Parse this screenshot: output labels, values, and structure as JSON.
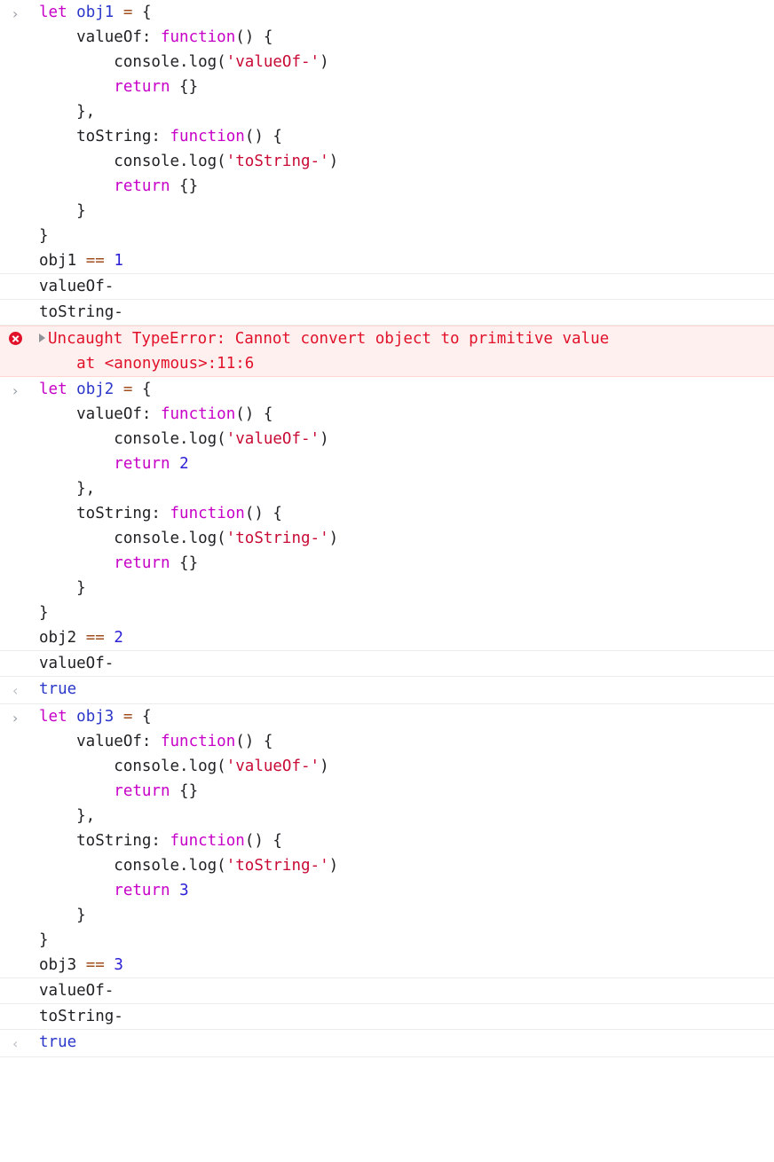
{
  "app": {
    "name": "browser-devtools-console",
    "theme": "light"
  },
  "colors": {
    "keyword": "#c700c7",
    "identifier": "#2a37c9",
    "operator": "#a14d1d",
    "string": "#c80a34",
    "number": "#2a1fd4",
    "plain": "#202124",
    "error_text": "#e2112a",
    "error_background": "#fdf0ef",
    "error_border": "#ffd6d2",
    "gutter": "#9aa0a6",
    "separator": "#ececec",
    "result": "#2a37c9"
  },
  "markers": {
    "input_prompt": "›",
    "result_prompt": "‹",
    "error_icon": "error-circle-x-icon",
    "error_disclosure": "disclosure-triangle-right-icon"
  },
  "entries": [
    {
      "kind": "input",
      "name": "console-input-obj1",
      "lines": [
        [
          {
            "t": "let ",
            "c": "kw"
          },
          {
            "t": "obj1",
            "c": "ident"
          },
          {
            "t": " ",
            "c": "plain"
          },
          {
            "t": "=",
            "c": "op"
          },
          {
            "t": " {",
            "c": "plain"
          }
        ],
        [
          {
            "t": "    valueOf: ",
            "c": "plain"
          },
          {
            "t": "function",
            "c": "kw"
          },
          {
            "t": "() {",
            "c": "plain"
          }
        ],
        [
          {
            "t": "        console.log(",
            "c": "plain"
          },
          {
            "t": "'valueOf-'",
            "c": "str"
          },
          {
            "t": ")",
            "c": "plain"
          }
        ],
        [
          {
            "t": "        ",
            "c": "plain"
          },
          {
            "t": "return",
            "c": "kw"
          },
          {
            "t": " {}",
            "c": "plain"
          }
        ],
        [
          {
            "t": "    },",
            "c": "plain"
          }
        ],
        [
          {
            "t": "    toString: ",
            "c": "plain"
          },
          {
            "t": "function",
            "c": "kw"
          },
          {
            "t": "() {",
            "c": "plain"
          }
        ],
        [
          {
            "t": "        console.log(",
            "c": "plain"
          },
          {
            "t": "'toString-'",
            "c": "str"
          },
          {
            "t": ")",
            "c": "plain"
          }
        ],
        [
          {
            "t": "        ",
            "c": "plain"
          },
          {
            "t": "return",
            "c": "kw"
          },
          {
            "t": " {}",
            "c": "plain"
          }
        ],
        [
          {
            "t": "    }",
            "c": "plain"
          }
        ],
        [
          {
            "t": "}",
            "c": "plain"
          }
        ],
        [
          {
            "t": "obj1 ",
            "c": "plain"
          },
          {
            "t": "==",
            "c": "op"
          },
          {
            "t": " ",
            "c": "plain"
          },
          {
            "t": "1",
            "c": "num"
          }
        ]
      ]
    },
    {
      "kind": "log",
      "name": "console-log-valueof-1",
      "text": "valueOf-"
    },
    {
      "kind": "log",
      "name": "console-log-tostring-1",
      "text": "toString-"
    },
    {
      "kind": "error",
      "name": "console-error-typeerror",
      "message": "Uncaught TypeError: Cannot convert object to primitive value",
      "stack": "    at <anonymous>:11:6"
    },
    {
      "kind": "input",
      "name": "console-input-obj2",
      "lines": [
        [
          {
            "t": "let ",
            "c": "kw"
          },
          {
            "t": "obj2",
            "c": "ident"
          },
          {
            "t": " ",
            "c": "plain"
          },
          {
            "t": "=",
            "c": "op"
          },
          {
            "t": " {",
            "c": "plain"
          }
        ],
        [
          {
            "t": "    valueOf: ",
            "c": "plain"
          },
          {
            "t": "function",
            "c": "kw"
          },
          {
            "t": "() {",
            "c": "plain"
          }
        ],
        [
          {
            "t": "        console.log(",
            "c": "plain"
          },
          {
            "t": "'valueOf-'",
            "c": "str"
          },
          {
            "t": ")",
            "c": "plain"
          }
        ],
        [
          {
            "t": "        ",
            "c": "plain"
          },
          {
            "t": "return",
            "c": "kw"
          },
          {
            "t": " ",
            "c": "plain"
          },
          {
            "t": "2",
            "c": "num"
          }
        ],
        [
          {
            "t": "    },",
            "c": "plain"
          }
        ],
        [
          {
            "t": "    toString: ",
            "c": "plain"
          },
          {
            "t": "function",
            "c": "kw"
          },
          {
            "t": "() {",
            "c": "plain"
          }
        ],
        [
          {
            "t": "        console.log(",
            "c": "plain"
          },
          {
            "t": "'toString-'",
            "c": "str"
          },
          {
            "t": ")",
            "c": "plain"
          }
        ],
        [
          {
            "t": "        ",
            "c": "plain"
          },
          {
            "t": "return",
            "c": "kw"
          },
          {
            "t": " {}",
            "c": "plain"
          }
        ],
        [
          {
            "t": "    }",
            "c": "plain"
          }
        ],
        [
          {
            "t": "}",
            "c": "plain"
          }
        ],
        [
          {
            "t": "obj2 ",
            "c": "plain"
          },
          {
            "t": "==",
            "c": "op"
          },
          {
            "t": " ",
            "c": "plain"
          },
          {
            "t": "2",
            "c": "num"
          }
        ]
      ]
    },
    {
      "kind": "log",
      "name": "console-log-valueof-2",
      "text": "valueOf-"
    },
    {
      "kind": "result",
      "name": "console-result-true-1",
      "text": "true"
    },
    {
      "kind": "input",
      "name": "console-input-obj3",
      "lines": [
        [
          {
            "t": "let ",
            "c": "kw"
          },
          {
            "t": "obj3",
            "c": "ident"
          },
          {
            "t": " ",
            "c": "plain"
          },
          {
            "t": "=",
            "c": "op"
          },
          {
            "t": " {",
            "c": "plain"
          }
        ],
        [
          {
            "t": "    valueOf: ",
            "c": "plain"
          },
          {
            "t": "function",
            "c": "kw"
          },
          {
            "t": "() {",
            "c": "plain"
          }
        ],
        [
          {
            "t": "        console.log(",
            "c": "plain"
          },
          {
            "t": "'valueOf-'",
            "c": "str"
          },
          {
            "t": ")",
            "c": "plain"
          }
        ],
        [
          {
            "t": "        ",
            "c": "plain"
          },
          {
            "t": "return",
            "c": "kw"
          },
          {
            "t": " {}",
            "c": "plain"
          }
        ],
        [
          {
            "t": "    },",
            "c": "plain"
          }
        ],
        [
          {
            "t": "    toString: ",
            "c": "plain"
          },
          {
            "t": "function",
            "c": "kw"
          },
          {
            "t": "() {",
            "c": "plain"
          }
        ],
        [
          {
            "t": "        console.log(",
            "c": "plain"
          },
          {
            "t": "'toString-'",
            "c": "str"
          },
          {
            "t": ")",
            "c": "plain"
          }
        ],
        [
          {
            "t": "        ",
            "c": "plain"
          },
          {
            "t": "return",
            "c": "kw"
          },
          {
            "t": " ",
            "c": "plain"
          },
          {
            "t": "3",
            "c": "num"
          }
        ],
        [
          {
            "t": "    }",
            "c": "plain"
          }
        ],
        [
          {
            "t": "}",
            "c": "plain"
          }
        ],
        [
          {
            "t": "obj3 ",
            "c": "plain"
          },
          {
            "t": "==",
            "c": "op"
          },
          {
            "t": " ",
            "c": "plain"
          },
          {
            "t": "3",
            "c": "num"
          }
        ]
      ]
    },
    {
      "kind": "log",
      "name": "console-log-valueof-3",
      "text": "valueOf-"
    },
    {
      "kind": "log",
      "name": "console-log-tostring-3",
      "text": "toString-"
    },
    {
      "kind": "result",
      "name": "console-result-true-2",
      "text": "true"
    }
  ]
}
